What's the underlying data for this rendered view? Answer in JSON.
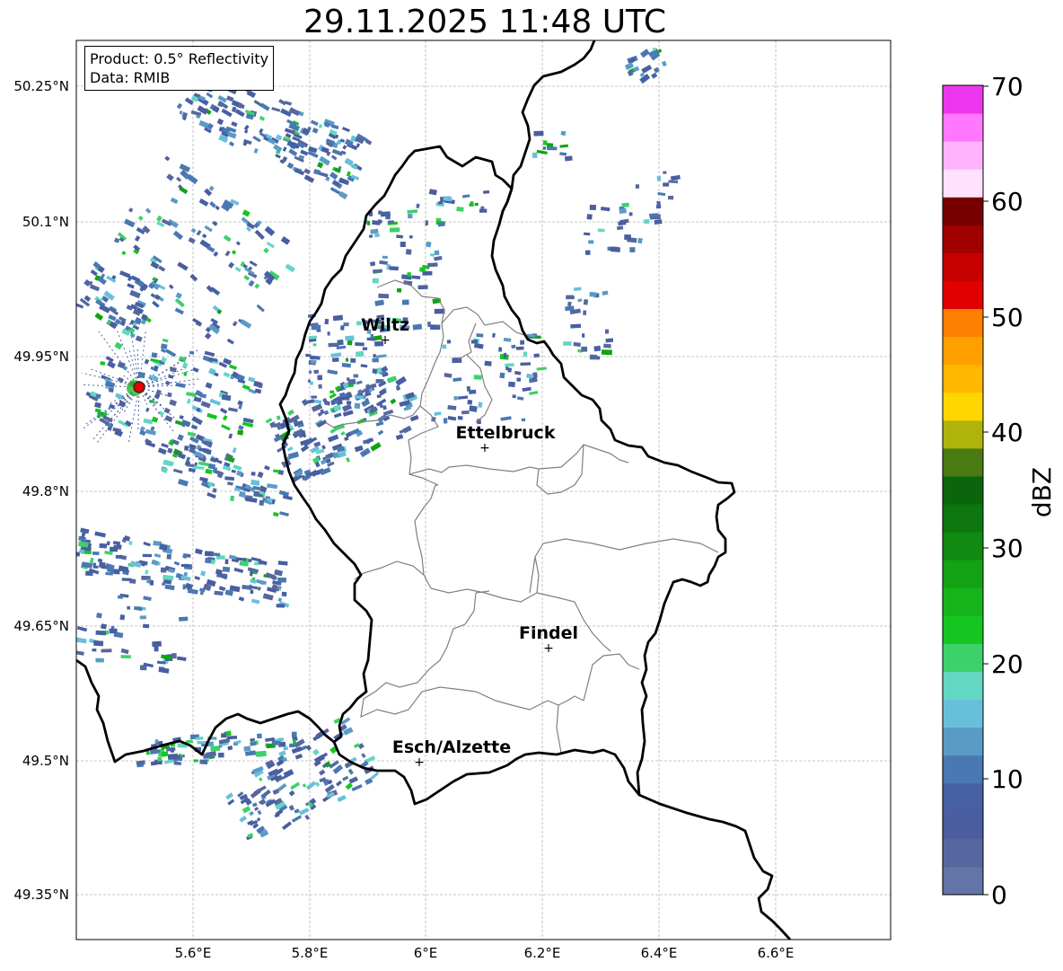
{
  "title": "29.11.2025 11:48 UTC",
  "info": {
    "product": "Product: 0.5° Reflectivity",
    "data": "Data: RMIB"
  },
  "axes": {
    "lon_ticks": [
      "5.6°E",
      "5.8°E",
      "6°E",
      "6.2°E",
      "6.4°E",
      "6.6°E"
    ],
    "lat_ticks": [
      "50.25°N",
      "50.1°N",
      "49.95°N",
      "49.8°N",
      "49.65°N",
      "49.5°N",
      "49.35°N"
    ]
  },
  "cities": [
    {
      "name": "Wiltz"
    },
    {
      "name": "Ettelbruck"
    },
    {
      "name": "Findel"
    },
    {
      "name": "Esch/Alzette"
    }
  ],
  "colorbar": {
    "label": "dBZ",
    "ticks": [
      "0",
      "10",
      "20",
      "30",
      "40",
      "50",
      "60",
      "70"
    ],
    "colors": [
      "#6374a6",
      "#56679f",
      "#4a5d9e",
      "#4660a3",
      "#4a78b2",
      "#5a9bc6",
      "#67c0da",
      "#63d6c4",
      "#3dd16a",
      "#15c520",
      "#16b41a",
      "#12a214",
      "#108a10",
      "#0d760f",
      "#0b650c",
      "#4a7b12",
      "#b0b30a",
      "#ffd700",
      "#ffb700",
      "#ffa000",
      "#ff7f00",
      "#e10000",
      "#c60000",
      "#a00000",
      "#780000",
      "#ffe0ff",
      "#ffb3ff",
      "#ff78ff",
      "#ee36ee"
    ]
  }
}
